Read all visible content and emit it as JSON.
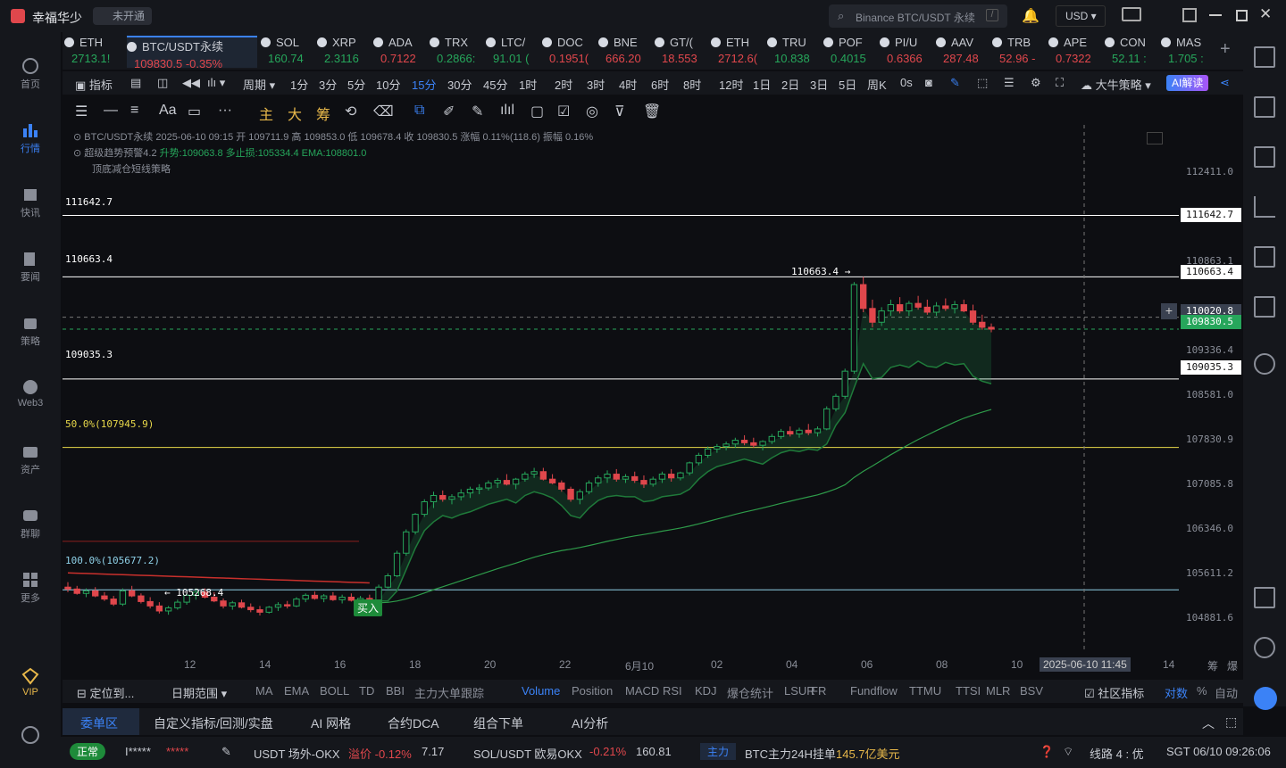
{
  "app": {
    "title": "幸福华少",
    "badge": "未开通",
    "search_placeholder": "Binance BTC/USDT 永续",
    "currency": "USD"
  },
  "nav": [
    {
      "label": "首页"
    },
    {
      "label": "行情"
    },
    {
      "label": "快讯"
    },
    {
      "label": "要闻"
    },
    {
      "label": "策略"
    },
    {
      "label": "Web3"
    },
    {
      "label": "资产"
    },
    {
      "label": "群聊"
    },
    {
      "label": "更多"
    },
    {
      "label": "VIP"
    }
  ],
  "tickers": [
    {
      "sym": "ETH",
      "px": "2713.1!",
      "dir": "up"
    },
    {
      "sym": "BTC/USDT永续",
      "px": "109830.5  -0.35%",
      "dir": "down"
    },
    {
      "sym": "SOL",
      "px": "160.74",
      "dir": "up"
    },
    {
      "sym": "XRP",
      "px": "2.3116",
      "dir": "up"
    },
    {
      "sym": "ADA",
      "px": "0.7122",
      "dir": "down"
    },
    {
      "sym": "TRX",
      "px": "0.2866:",
      "dir": "up"
    },
    {
      "sym": "LTC/",
      "px": "91.01 (",
      "dir": "up"
    },
    {
      "sym": "DOC",
      "px": "0.1951(",
      "dir": "down"
    },
    {
      "sym": "BNE",
      "px": "666.20",
      "dir": "down"
    },
    {
      "sym": "GT/(",
      "px": "18.553",
      "dir": "down"
    },
    {
      "sym": "ETH",
      "px": "2712.6(",
      "dir": "down"
    },
    {
      "sym": "TRU",
      "px": "10.838",
      "dir": "up"
    },
    {
      "sym": "POF",
      "px": "0.4015",
      "dir": "up"
    },
    {
      "sym": "PI/U",
      "px": "0.6366",
      "dir": "down"
    },
    {
      "sym": "AAV",
      "px": "287.48",
      "dir": "down"
    },
    {
      "sym": "TRB",
      "px": "52.96 -",
      "dir": "down"
    },
    {
      "sym": "APE",
      "px": "0.7322",
      "dir": "down"
    },
    {
      "sym": "CON",
      "px": "52.11 :",
      "dir": "up"
    },
    {
      "sym": "MAS",
      "px": "1.705 :",
      "dir": "up"
    }
  ],
  "intervals": {
    "indicator": "指标",
    "period": "周期",
    "items": [
      "1分",
      "3分",
      "5分",
      "10分",
      "15分",
      "30分",
      "45分",
      "1时",
      "2时",
      "3时",
      "4时",
      "6时",
      "8时",
      "12时",
      "1日",
      "2日",
      "3日",
      "5日",
      "周K"
    ],
    "active": "15分",
    "countdown": "0s",
    "strategy": "大牛策略",
    "ai": "AI解读"
  },
  "toolbar": {
    "labels": [
      "Aa",
      "主",
      "大",
      "筹"
    ]
  },
  "chart": {
    "header": "BTC/USDT永续  2025-06-10 09:15  开 109711.9  高 109853.0  低 109678.4  收 109830.5  涨幅 0.11%(118.6)  振幅 0.16%",
    "ind1_name": "超级趋势预警4.2",
    "ind1_vals": "升势:109063.8  多止损:105334.4  EMA:108801.0",
    "ind2_name": "顶底减仓短线策略",
    "hlines": [
      {
        "label": "111642.7"
      },
      {
        "label": "110663.4"
      },
      {
        "label": "109035.3"
      }
    ],
    "fib50": "50.0%(107945.9)",
    "fib100": "100.0%(105677.2)",
    "low_label": "← 105268.4",
    "high_label": "110663.4 →",
    "buy": "买入",
    "yaxis": [
      "112411.0",
      "110863.1",
      "109336.4",
      "108581.0",
      "107830.9",
      "107085.8",
      "106346.0",
      "105611.2",
      "104881.6"
    ],
    "tags": {
      "t1": "111642.7",
      "t2": "110663.4",
      "t3": "110020.8",
      "t4": "109830.5",
      "t5": "109035.3"
    },
    "xaxis": [
      "12",
      "14",
      "16",
      "18",
      "20",
      "22",
      "6月10",
      "02",
      "04",
      "06",
      "08",
      "10",
      "14"
    ],
    "cursor_time": "2025-06-10 11:45",
    "corner": [
      "筹",
      "爆"
    ]
  },
  "chart_data": {
    "type": "candlestick",
    "symbol": "BTC/USDT永续",
    "interval": "15分",
    "ylim": [
      104700,
      112800
    ],
    "candles": [
      [
        105720,
        105800,
        105640,
        105690
      ],
      [
        105690,
        105740,
        105600,
        105620
      ],
      [
        105620,
        105700,
        105560,
        105660
      ],
      [
        105660,
        105720,
        105560,
        105580
      ],
      [
        105580,
        105640,
        105500,
        105530
      ],
      [
        105530,
        105580,
        105420,
        105450
      ],
      [
        105450,
        105700,
        105420,
        105660
      ],
      [
        105660,
        105740,
        105560,
        105580
      ],
      [
        105580,
        105620,
        105460,
        105490
      ],
      [
        105490,
        105560,
        105380,
        105420
      ],
      [
        105420,
        105480,
        105300,
        105340
      ],
      [
        105340,
        105420,
        105280,
        105390
      ],
      [
        105390,
        105520,
        105360,
        105480
      ],
      [
        105480,
        105620,
        105440,
        105590
      ],
      [
        105590,
        105700,
        105520,
        105640
      ],
      [
        105640,
        105700,
        105540,
        105560
      ],
      [
        105560,
        105640,
        105480,
        105500
      ],
      [
        105500,
        105540,
        105380,
        105420
      ],
      [
        105420,
        105500,
        105360,
        105470
      ],
      [
        105470,
        105520,
        105380,
        105400
      ],
      [
        105400,
        105460,
        105320,
        105360
      ],
      [
        105360,
        105420,
        105268,
        105320
      ],
      [
        105320,
        105420,
        105300,
        105400
      ],
      [
        105400,
        105480,
        105340,
        105440
      ],
      [
        105440,
        105500,
        105380,
        105420
      ],
      [
        105420,
        105560,
        105400,
        105530
      ],
      [
        105530,
        105620,
        105480,
        105590
      ],
      [
        105590,
        105650,
        105520,
        105540
      ],
      [
        105540,
        105610,
        105480,
        105580
      ],
      [
        105580,
        105640,
        105500,
        105520
      ],
      [
        105520,
        105600,
        105460,
        105560
      ],
      [
        105560,
        105620,
        105490,
        105510
      ],
      [
        105510,
        105580,
        105460,
        105540
      ],
      [
        105540,
        105600,
        105480,
        105500
      ],
      [
        105500,
        105760,
        105480,
        105720
      ],
      [
        105720,
        105940,
        105700,
        105900
      ],
      [
        105900,
        106300,
        105880,
        106260
      ],
      [
        106260,
        106640,
        106220,
        106600
      ],
      [
        106600,
        106900,
        106560,
        106880
      ],
      [
        106880,
        107120,
        106840,
        107080
      ],
      [
        107080,
        107240,
        106980,
        107180
      ],
      [
        107180,
        107260,
        107080,
        107120
      ],
      [
        107120,
        107200,
        107040,
        107160
      ],
      [
        107160,
        107280,
        107100,
        107220
      ],
      [
        107220,
        107320,
        107140,
        107280
      ],
      [
        107280,
        107360,
        107200,
        107300
      ],
      [
        107300,
        107420,
        107260,
        107380
      ],
      [
        107380,
        107460,
        107300,
        107420
      ],
      [
        107420,
        107520,
        107340,
        107360
      ],
      [
        107360,
        107460,
        107280,
        107440
      ],
      [
        107440,
        107560,
        107400,
        107520
      ],
      [
        107520,
        107620,
        107460,
        107560
      ],
      [
        107560,
        107620,
        107420,
        107440
      ],
      [
        107440,
        107520,
        107360,
        107380
      ],
      [
        107380,
        107420,
        107240,
        107280
      ],
      [
        107280,
        107320,
        107080,
        107120
      ],
      [
        107120,
        107280,
        107040,
        107240
      ],
      [
        107240,
        107420,
        107200,
        107380
      ],
      [
        107380,
        107500,
        107320,
        107460
      ],
      [
        107460,
        107580,
        107380,
        107520
      ],
      [
        107520,
        107600,
        107400,
        107440
      ],
      [
        107440,
        107520,
        107380,
        107480
      ],
      [
        107480,
        107560,
        107380,
        107420
      ],
      [
        107420,
        107500,
        107300,
        107360
      ],
      [
        107360,
        107480,
        107320,
        107440
      ],
      [
        107440,
        107560,
        107380,
        107520
      ],
      [
        107520,
        107600,
        107400,
        107460
      ],
      [
        107460,
        107560,
        107420,
        107540
      ],
      [
        107540,
        107720,
        107500,
        107700
      ],
      [
        107700,
        107860,
        107660,
        107820
      ],
      [
        107820,
        107960,
        107780,
        107920
      ],
      [
        107920,
        108000,
        107860,
        107960
      ],
      [
        107960,
        108040,
        107900,
        108000
      ],
      [
        108000,
        108100,
        107940,
        108060
      ],
      [
        108060,
        108140,
        107980,
        108020
      ],
      [
        108020,
        108100,
        107940,
        107980
      ],
      [
        107980,
        108060,
        107900,
        108040
      ],
      [
        108040,
        108160,
        108000,
        108120
      ],
      [
        108120,
        108240,
        108080,
        108200
      ],
      [
        108200,
        108280,
        108120,
        108160
      ],
      [
        108160,
        108260,
        108100,
        108220
      ],
      [
        108220,
        108320,
        108140,
        108180
      ],
      [
        108180,
        108280,
        108120,
        108240
      ],
      [
        108240,
        108600,
        108220,
        108560
      ],
      [
        108560,
        108800,
        108520,
        108760
      ],
      [
        108760,
        109200,
        108720,
        109160
      ],
      [
        109160,
        110580,
        109120,
        110540
      ],
      [
        110540,
        110663,
        110100,
        110160
      ],
      [
        110160,
        110300,
        109860,
        109940
      ],
      [
        109940,
        110180,
        109880,
        110120
      ],
      [
        110120,
        110300,
        110040,
        110220
      ],
      [
        110220,
        110340,
        110080,
        110120
      ],
      [
        110120,
        110280,
        110040,
        110240
      ],
      [
        110240,
        110360,
        110140,
        110180
      ],
      [
        110180,
        110300,
        110060,
        110100
      ],
      [
        110100,
        110260,
        110040,
        110200
      ],
      [
        110200,
        110320,
        110120,
        110160
      ],
      [
        110160,
        110280,
        110080,
        110220
      ],
      [
        110220,
        110300,
        110100,
        110120
      ],
      [
        110120,
        110220,
        109900,
        109940
      ],
      [
        109940,
        110060,
        109820,
        109860
      ],
      [
        109860,
        109920,
        109780,
        109830
      ]
    ]
  },
  "bottom": {
    "locate": "定位到...",
    "range": "日期范围",
    "items": [
      "MA",
      "EMA",
      "BOLL",
      "TD",
      "BBI",
      "主力大单跟踪"
    ],
    "items2": [
      "Volume",
      "Position",
      "MACD",
      "RSI",
      "KDJ",
      "爆仓统计",
      "LSUR",
      "FR",
      "Fundflow",
      "TTMU",
      "TTSI",
      "MLR",
      "BSV"
    ],
    "community": "社区指标",
    "dual": "对数",
    "pct": "%",
    "auto": "自动"
  },
  "panels": [
    "委单区",
    "自定义指标/回测/实盘",
    "AI 网格",
    "合约DCA",
    "组合下单",
    "AI分析"
  ],
  "status": {
    "normal": "正常",
    "user": "I*****",
    "stars": "*****",
    "s1": "USDT 场外-OKX",
    "s1a": "溢价 -0.12%",
    "s1b": "7.17",
    "s2": "SOL/USDT 欧易OKX",
    "s2a": "-0.21%",
    "s2b": "160.81",
    "tag": "主力",
    "s3": "BTC主力24H挂单",
    "s3a": "145.7亿美元",
    "line": "线路 4 : 优",
    "time": "SGT 06/10 09:26:06"
  },
  "colors": {
    "up": "#26a65b",
    "down": "#e0474c",
    "accent": "#3b82f6",
    "fib": "#e8d84a",
    "fib100": "#8fd1e8"
  }
}
